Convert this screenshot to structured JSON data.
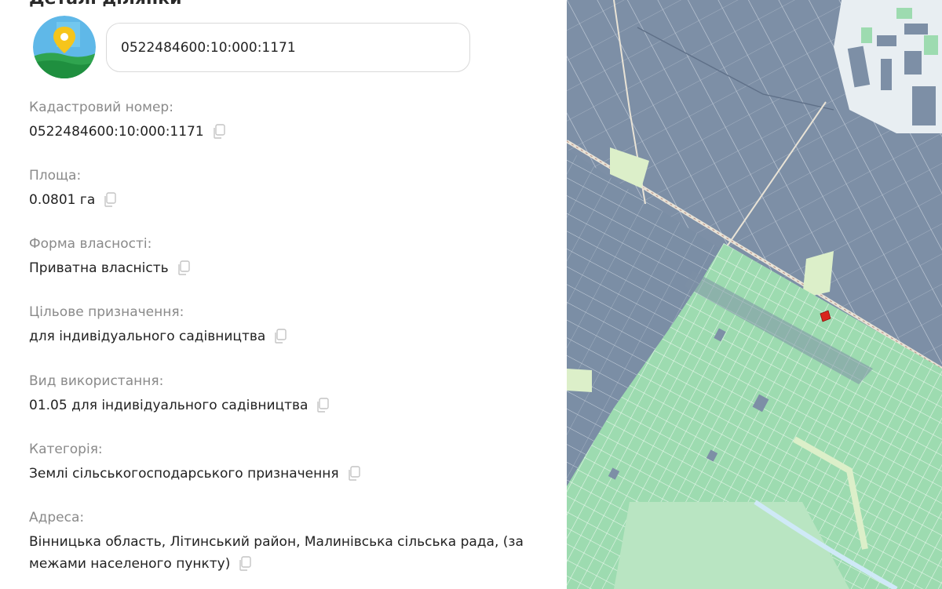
{
  "panel": {
    "title": "Деталі ділянки"
  },
  "search": {
    "value": "0522484600:10:000:1171"
  },
  "fields": [
    {
      "label": "Кадастровий номер:",
      "value": "0522484600:10:000:1171"
    },
    {
      "label": "Площа:",
      "value": "0.0801 га"
    },
    {
      "label": "Форма власності:",
      "value": "Приватна власність"
    },
    {
      "label": "Цільове призначення:",
      "value": "для індивідуального садівництва"
    },
    {
      "label": "Вид використання:",
      "value": "01.05 для індивідуального садівництва"
    },
    {
      "label": "Категорія:",
      "value": "Землі сільськогосподарського призначення"
    },
    {
      "label": "Адреса:",
      "value": "Вінницька область, Літинський район, Малинівська сільська рада, (за межами населеного пункту)"
    }
  ],
  "icons": {
    "logo": "map-pin-logo-icon",
    "copy": "copy-icon"
  },
  "colors": {
    "label": "#8a8a8a",
    "value": "#222222",
    "map_parcel_blue": "#7d8fa6",
    "map_parcel_green": "#9ddbb0",
    "map_highlight": "#d9251c",
    "map_pale": "#dcefc9"
  }
}
